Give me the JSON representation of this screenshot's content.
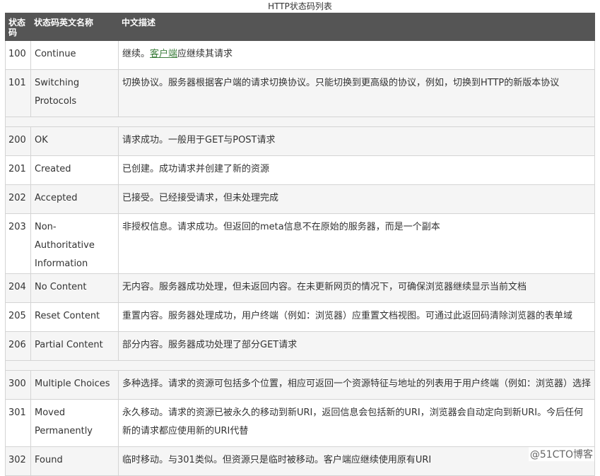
{
  "caption": "HTTP状态码列表",
  "headers": {
    "code": "状态码",
    "name": "状态码英文名称",
    "desc": "中文描述"
  },
  "rows": [
    {
      "code": "100",
      "name": "Continue",
      "desc_pre": "继续。",
      "desc_link": "客户端",
      "desc_post": "应继续其请求"
    },
    {
      "code": "101",
      "name": "Switching Protocols",
      "desc": "切换协议。服务器根据客户端的请求切换协议。只能切换到更高级的协议，例如，切换到HTTP的新版本协议"
    },
    {
      "code": "200",
      "name": "OK",
      "desc": "请求成功。一般用于GET与POST请求"
    },
    {
      "code": "201",
      "name": "Created",
      "desc": "已创建。成功请求并创建了新的资源"
    },
    {
      "code": "202",
      "name": "Accepted",
      "desc": "已接受。已经接受请求，但未处理完成"
    },
    {
      "code": "203",
      "name": "Non-Authoritative Information",
      "desc": "非授权信息。请求成功。但返回的meta信息不在原始的服务器，而是一个副本"
    },
    {
      "code": "204",
      "name": "No Content",
      "desc": "无内容。服务器成功处理，但未返回内容。在未更新网页的情况下，可确保浏览器继续显示当前文档"
    },
    {
      "code": "205",
      "name": "Reset Content",
      "desc": "重置内容。服务器处理成功，用户终端（例如：浏览器）应重置文档视图。可通过此返回码清除浏览器的表单域"
    },
    {
      "code": "206",
      "name": "Partial Content",
      "desc": "部分内容。服务器成功处理了部分GET请求"
    },
    {
      "code": "300",
      "name": "Multiple Choices",
      "desc": "多种选择。请求的资源可包括多个位置，相应可返回一个资源特征与地址的列表用于用户终端（例如：浏览器）选择"
    },
    {
      "code": "301",
      "name": "Moved Permanently",
      "desc": "永久移动。请求的资源已被永久的移动到新URI，返回信息会包括新的URI，浏览器会自动定向到新URI。今后任何新的请求都应使用新的URI代替"
    },
    {
      "code": "302",
      "name": "Found",
      "desc": "临时移动。与301类似。但资源只是临时被移动。客户端应继续使用原有URI"
    }
  ],
  "watermark": "@51CTO博客",
  "colors": {
    "header_bg": "#555555",
    "alt_row_bg": "#f5f5f5",
    "link": "#3c7e3c",
    "border": "#d4d4d4"
  }
}
